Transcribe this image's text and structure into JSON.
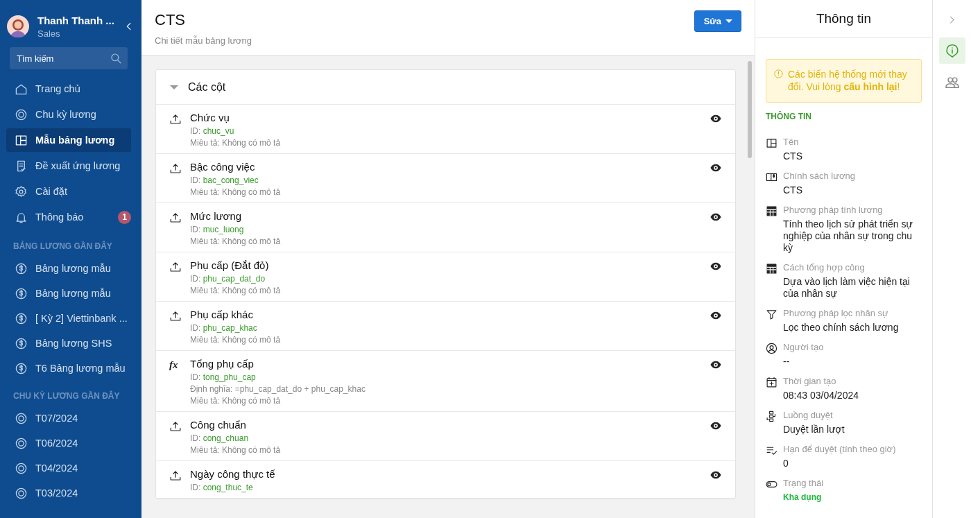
{
  "user": {
    "name": "Thanh Thanh ...",
    "role": "Sales"
  },
  "search": {
    "placeholder": "Tìm kiếm"
  },
  "nav": [
    {
      "label": "Trang chủ",
      "selected": false
    },
    {
      "label": "Chu kỳ lương",
      "selected": false
    },
    {
      "label": "Mẫu bảng lương",
      "selected": true
    },
    {
      "label": "Đề xuất ứng lương",
      "selected": false
    },
    {
      "label": "Cài đặt",
      "selected": false
    },
    {
      "label": "Thông báo",
      "selected": false,
      "badge": "1"
    }
  ],
  "recent_sections": [
    {
      "title": "BẢNG LƯƠNG GẦN ĐÂY",
      "kind": "payroll",
      "items": [
        "Bảng lương mẫu",
        "Bảng lương mẫu",
        "[ Kỳ 2] Viettinbank ...",
        "Bảng lương SHS",
        "T6 Bảng lương mẫu"
      ]
    },
    {
      "title": "CHU KỲ LƯƠNG GẦN ĐÂY",
      "kind": "cycle",
      "items": [
        "T07/2024",
        "T06/2024",
        "T04/2024",
        "T03/2024"
      ]
    }
  ],
  "page": {
    "title": "CTS",
    "subtitle": "Chi tiết mẫu bảng lương",
    "edit_button": "Sửa"
  },
  "columns_card": {
    "title": "Các cột",
    "expanded": true,
    "rows": [
      {
        "kind": "input",
        "name": "Chức vụ",
        "id_label": "ID:",
        "id": "chuc_vu",
        "description": "Miêu tả: Không có mô tả"
      },
      {
        "kind": "input",
        "name": "Bậc công việc",
        "id_label": "ID:",
        "id": "bac_cong_viec",
        "description": "Miêu tả: Không có mô tả"
      },
      {
        "kind": "input",
        "name": "Mức lương",
        "id_label": "ID:",
        "id": "muc_luong",
        "description": "Miêu tả: Không có mô tả"
      },
      {
        "kind": "input",
        "name": "Phụ cấp (Đắt đỏ)",
        "id_label": "ID:",
        "id": "phu_cap_dat_do",
        "description": "Miêu tả: Không có mô tả"
      },
      {
        "kind": "input",
        "name": "Phụ cấp khác",
        "id_label": "ID:",
        "id": "phu_cap_khac",
        "description": "Miêu tả: Không có mô tả"
      },
      {
        "kind": "formula",
        "symbol": "fx",
        "name": "Tổng phụ cấp",
        "id_label": "ID:",
        "id": "tong_phu_cap",
        "definition": "Định nghĩa: =phu_cap_dat_do + phu_cap_khac",
        "description": "Miêu tả: Không có mô tả"
      },
      {
        "kind": "input",
        "name": "Công chuẩn",
        "id_label": "ID:",
        "id": "cong_chuan",
        "description": "Miêu tả: Không có mô tả"
      },
      {
        "kind": "input",
        "name": "Ngày công thực tế",
        "id_label": "ID:",
        "id": "cong_thuc_te"
      }
    ]
  },
  "info_panel": {
    "title": "Thông tin",
    "warning": "Các biến hệ thống mới thay đổi. Vui lòng **cấu hình lại**!",
    "section_title": "THÔNG TIN",
    "fields": [
      {
        "label": "Tên",
        "value": "CTS",
        "kind": "text"
      },
      {
        "label": "Chính sách lương",
        "value": "CTS",
        "kind": "text"
      },
      {
        "label": "Phương pháp tính lương",
        "value": "Tính theo lịch sử phát triển sự nghiệp của nhân sự trong chu kỳ",
        "kind": "text"
      },
      {
        "label": "Cách tổng hợp công",
        "value": "Dựa vào lịch làm việc hiện tại của nhân sự",
        "kind": "text"
      },
      {
        "label": "Phương pháp lọc nhân sự",
        "value": "Lọc theo chính sách lương",
        "kind": "text"
      },
      {
        "label": "Người tạo",
        "value": "--",
        "kind": "text"
      },
      {
        "label": "Thời gian tạo",
        "value": "08:43 03/04/2024",
        "kind": "text"
      },
      {
        "label": "Luồng duyệt",
        "value": "Duyệt lần lượt",
        "kind": "text"
      },
      {
        "label": "Hạn để duyệt (tính theo giờ)",
        "value": "0",
        "kind": "text"
      },
      {
        "label": "Trạng thái",
        "value": "Khả dụng",
        "kind": "status"
      }
    ]
  },
  "rail": [
    {
      "selected": true
    },
    {
      "selected": false
    }
  ]
}
